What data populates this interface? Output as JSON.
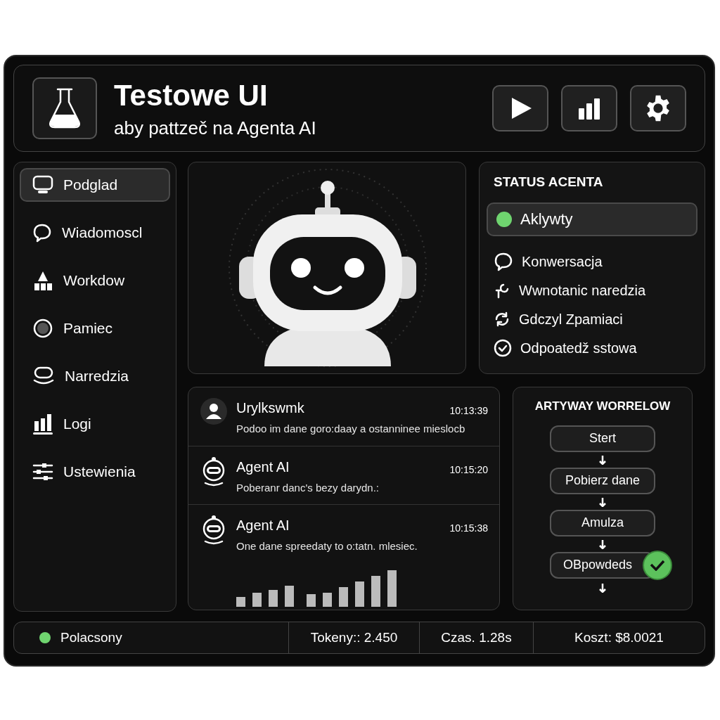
{
  "header": {
    "title": "Testowe UI",
    "subtitle": "aby pattzeč na Agenta AI",
    "buttons": [
      {
        "kind": "play"
      },
      {
        "kind": "chart"
      },
      {
        "kind": "settings"
      }
    ]
  },
  "sidebar": {
    "items": [
      {
        "label": "Podglad",
        "selected": true
      },
      {
        "label": "Wiadomoscl",
        "selected": false
      },
      {
        "label": "Workdow",
        "selected": false
      },
      {
        "label": "Pamiec",
        "selected": false
      },
      {
        "label": "Narredzia",
        "selected": false
      },
      {
        "label": "Logi",
        "selected": false
      },
      {
        "label": "Ustewienia",
        "selected": false
      }
    ]
  },
  "agent_status": {
    "title": "STATUS ACENTA",
    "state": {
      "label": "Aklywty",
      "color": "#6fd46f"
    },
    "items": [
      {
        "label": "Konwersacja"
      },
      {
        "label": "Wwnotanic naredzia"
      },
      {
        "label": "Gdczyl Zpamiaci"
      },
      {
        "label": "Odpoatedž sstowa"
      }
    ]
  },
  "messages": [
    {
      "author": "Urylkswmk",
      "kind": "user",
      "time": "10:13:39",
      "text": "Podoo im dane goro:daay a ostanninee mieslocb"
    },
    {
      "author": "Agent AI",
      "kind": "agent",
      "time": "10:15:20",
      "text": "Poberanr danc's bezy darydn.:"
    },
    {
      "author": "Agent AI",
      "kind": "agent",
      "time": "10:15:38",
      "text": "One dane spreedaty to o:tatn. mlesiec.",
      "chart": true
    }
  ],
  "workflow": {
    "title": "ARTYWAY WORRELOW",
    "steps": [
      {
        "label": "Stert",
        "done": false
      },
      {
        "label": "Pobierz dane",
        "done": false
      },
      {
        "label": "Amulza",
        "done": false
      },
      {
        "label": "OBpowdeds",
        "done": true
      }
    ]
  },
  "status_bar": {
    "connection": {
      "label": "Polacsony",
      "color": "#6fd46f"
    },
    "stats": [
      "Tokeny:: 2.450",
      "Czas. 1.28s",
      "Koszt: $8.0021"
    ]
  }
}
